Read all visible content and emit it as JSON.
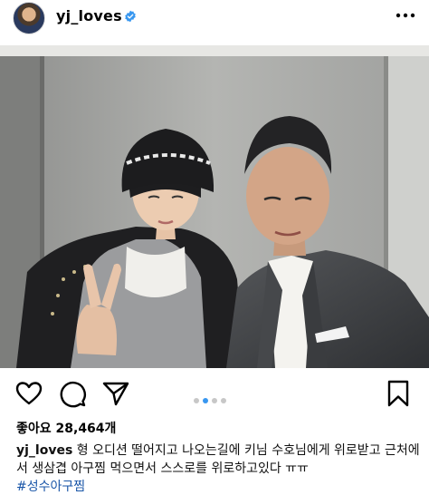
{
  "post": {
    "username": "yj_loves",
    "likes_text": "좋아요 28,464개",
    "caption_text": "형 오디션 떨어지고 나오는길에 키님 수호님에게 위로받고 근처에서 생삼겹 아구찜 먹으면서 스스로를 위로하고있다 ㅠㅠ",
    "hashtag": "#성수아구찜"
  },
  "carousel": {
    "count": 4,
    "active_index": 1
  },
  "colors": {
    "verified": "#3897f0",
    "hashtag": "#1a56a8",
    "dot_active": "#3897f0",
    "dot_inactive": "#c7c7c7"
  },
  "icons": {
    "like": "heart-icon",
    "comment": "comment-bubble-icon",
    "share": "paper-plane-icon",
    "save": "bookmark-icon",
    "more": "more-options-icon",
    "verified": "verified-badge-icon"
  }
}
